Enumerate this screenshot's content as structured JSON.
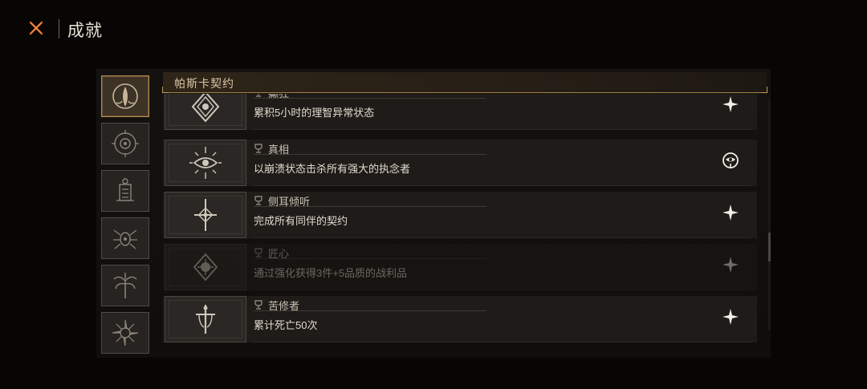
{
  "header": {
    "close_icon": "x-close-icon",
    "title": "成就"
  },
  "category_tabs": [
    {
      "icon": "tentacle-crest-icon",
      "active": true
    },
    {
      "icon": "eye-sigil-icon",
      "active": false
    },
    {
      "icon": "tower-sigil-icon",
      "active": false
    },
    {
      "icon": "spider-sigil-icon",
      "active": false
    },
    {
      "icon": "palm-sigil-icon",
      "active": false
    },
    {
      "icon": "thorn-sigil-icon",
      "active": false
    }
  ],
  "section": {
    "title": "帕斯卡契约"
  },
  "achievements": [
    {
      "title": "癫狂",
      "description": "累积5小时的理智异常状态",
      "icon": "rune-diamond-icon",
      "badge": "star-icon",
      "unlocked": true
    },
    {
      "title": "真相",
      "description": "以崩溃状态击杀所有强大的执念者",
      "icon": "radiant-eye-icon",
      "badge": "eye-emblem-icon",
      "unlocked": true
    },
    {
      "title": "侧耳倾听",
      "description": "完成所有同伴的契约",
      "icon": "cross-star-icon",
      "badge": "star-icon",
      "unlocked": true
    },
    {
      "title": "匠心",
      "description": "通过强化获得3件+5品质的战利品",
      "icon": "sun-sigil-icon",
      "badge": "star-icon",
      "unlocked": false
    },
    {
      "title": "苦修者",
      "description": "累计死亡50次",
      "icon": "dagger-cross-icon",
      "badge": "star-icon",
      "unlocked": true
    }
  ],
  "colors": {
    "accent": "#e06a2a",
    "gold": "#c29a5a",
    "background": "#070605"
  }
}
